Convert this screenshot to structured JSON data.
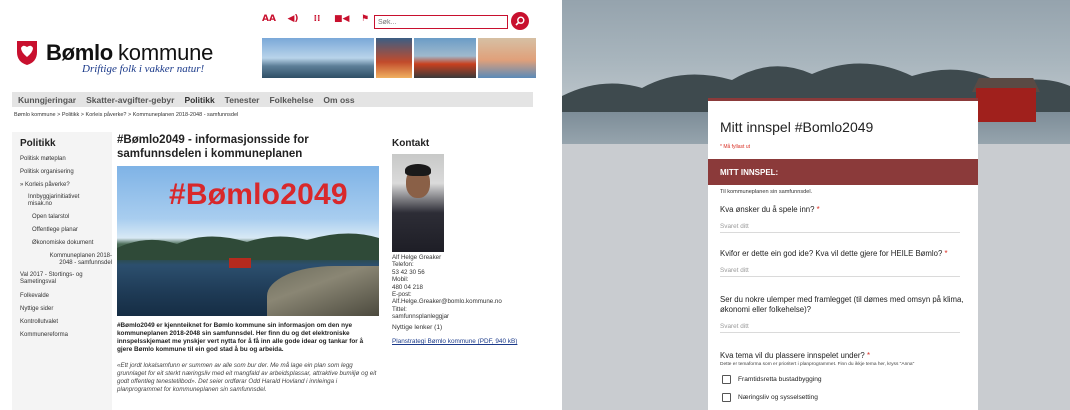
{
  "left": {
    "search": {
      "placeholder": "Søk..."
    },
    "util_icons": [
      "AA",
      "◀)",
      "⁞⁞",
      "■◀",
      "⚑"
    ],
    "logo": {
      "bold": "Bømlo",
      "light": "kommune",
      "tagline": "Driftige folk i vakker natur!"
    },
    "nav": [
      "Kunngjeringar",
      "Skatter-avgifter-gebyr",
      "Politikk",
      "Tenester",
      "Folkehelse",
      "Om oss"
    ],
    "nav_active": "Politikk",
    "breadcrumb": "Bømlo kommune > Politikk > Korleis påverke? > Kommuneplanen 2018-2048 - samfunnsdel",
    "sidebar": {
      "heading": "Politikk",
      "items": [
        "Politisk møteplan",
        "Politisk organisering",
        "» Korleis påverke?",
        "Innbyggjarinitiativet\nmisak.no",
        "Open talarstol",
        "Offentlege planar",
        "Økonomiske dokument",
        "Kommuneplanen 2018-\n2048 - samfunnsdel",
        "Val 2017 - Stortings- og\nSametingsval",
        "Folkevalde",
        "Nyttige sider",
        "Kontrollutvalet",
        "Kommunereforma"
      ]
    },
    "article": {
      "title": "#Bømlo2049 - informasjonsside for samfunnsdelen i kommuneplanen",
      "photo_text": "#Bømlo2049",
      "intro": "#Bømlo2049 er kjennteiknet for Bømlo kommune sin informasjon om den nye kommuneplanen 2018-2048 sin samfunnsdel. Her finn du og det elektroniske innspelsskjemaet me ynskjer vert nytta for å få inn alle gode idear og tankar for å gjere Bømlo kommune til ein god stad å bu og arbeida.",
      "quote": "«Ett jordt lokalsamfunn er summen av alle som bur der. Me må lage ein plan som legg grunnlaget for eit sterkt næringsliv med eit mangfald av arbeidsplassar, attraktive bumiljø og eit godt offentleg tenestetilbod». Det seier ordførar Odd Harald Hovland i innleinga i planprogrammet for kommuneplanen sin samfunnsdel."
    },
    "contact": {
      "heading": "Kontakt",
      "lines": [
        "Alf Helge Greaker",
        "Telefon:",
        "53 42 30 56",
        "Mobil:",
        "480 04 218",
        "E-post:",
        "Alf.Helge.Greaker@bomlo.kommune.no",
        "Tittel:",
        "samfunnsplanleggjar"
      ],
      "links_heading": "Nyttige lenker (1)",
      "link": "Planstrategi Bømlo kommune (PDF, 940 kB)"
    }
  },
  "right": {
    "form_title": "Mitt innspel #Bomlo2049",
    "required_note": "* Må fyllast ut",
    "section_label": "MITT INNSPEL:",
    "section_desc": "Til kommuneplanen sin samfunnsdel.",
    "answer_placeholder": "Svaret ditt",
    "questions": [
      {
        "text": "Kva ønsker du å spele inn?",
        "required": "*"
      },
      {
        "text": "Kvifor er dette ein god ide? Kva vil dette gjere for HEILE Bømlo?",
        "required": "*"
      },
      {
        "text": "Ser du nokre ulemper med framlegget (til dømes med omsyn på klima, økonomi eller folkehelse)?",
        "required": ""
      },
      {
        "text": "Kva tema vil du plassere innspelet under?",
        "required": "*"
      }
    ],
    "q4_desc": "Dette er temaforma som er prioritert i planprogrammet. Finn du ikkje tema her, kryss \"Anna\"",
    "options": [
      "Framtidsretta bustadbygging",
      "Næringsliv og sysselsetting"
    ]
  }
}
